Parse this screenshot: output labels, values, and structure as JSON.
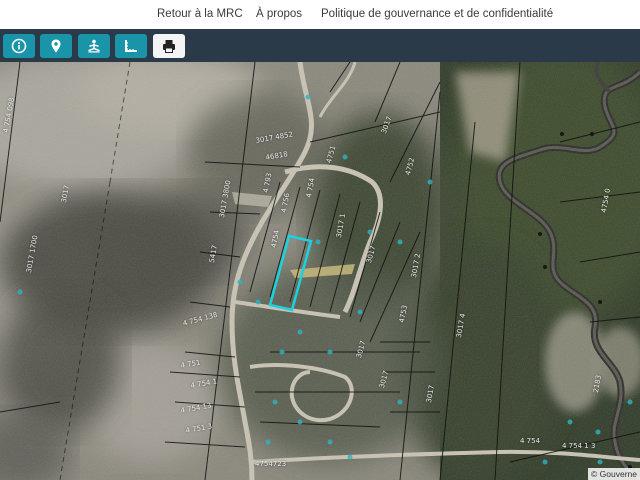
{
  "nav": {
    "items": [
      "Retour à la MRC",
      "À propos",
      "Politique de gouvernance et de confidentialité"
    ]
  },
  "toolbar": {
    "buttons": [
      {
        "icon": "info-icon"
      },
      {
        "icon": "map-pin-icon"
      },
      {
        "icon": "meditation-person-icon"
      },
      {
        "icon": "ruler-measure-icon"
      },
      {
        "icon": "print-icon"
      }
    ],
    "accent": "#1a94a8",
    "bar_color": "#2b3a48"
  },
  "map": {
    "selected_parcel_color": "#19d3e0",
    "lot_numbers": [
      "4 754 098",
      "3017 4852",
      "46818",
      "3017",
      "4751",
      "4 754 138",
      "3017 3800",
      "4 754",
      "3017 1700",
      "4 751",
      "4 754 1",
      "3017",
      "5417",
      "4 751 3",
      "4 754 13",
      "3017",
      "3017 2",
      "4754",
      "4 756",
      "4 793",
      "3017",
      "4754723",
      "3017",
      "4752",
      "4753",
      "3017 1",
      "4 754",
      "3017 4",
      "2183",
      "4 754 1 3",
      "3017",
      "4754 0"
    ],
    "attribution": "© Gouverne"
  }
}
